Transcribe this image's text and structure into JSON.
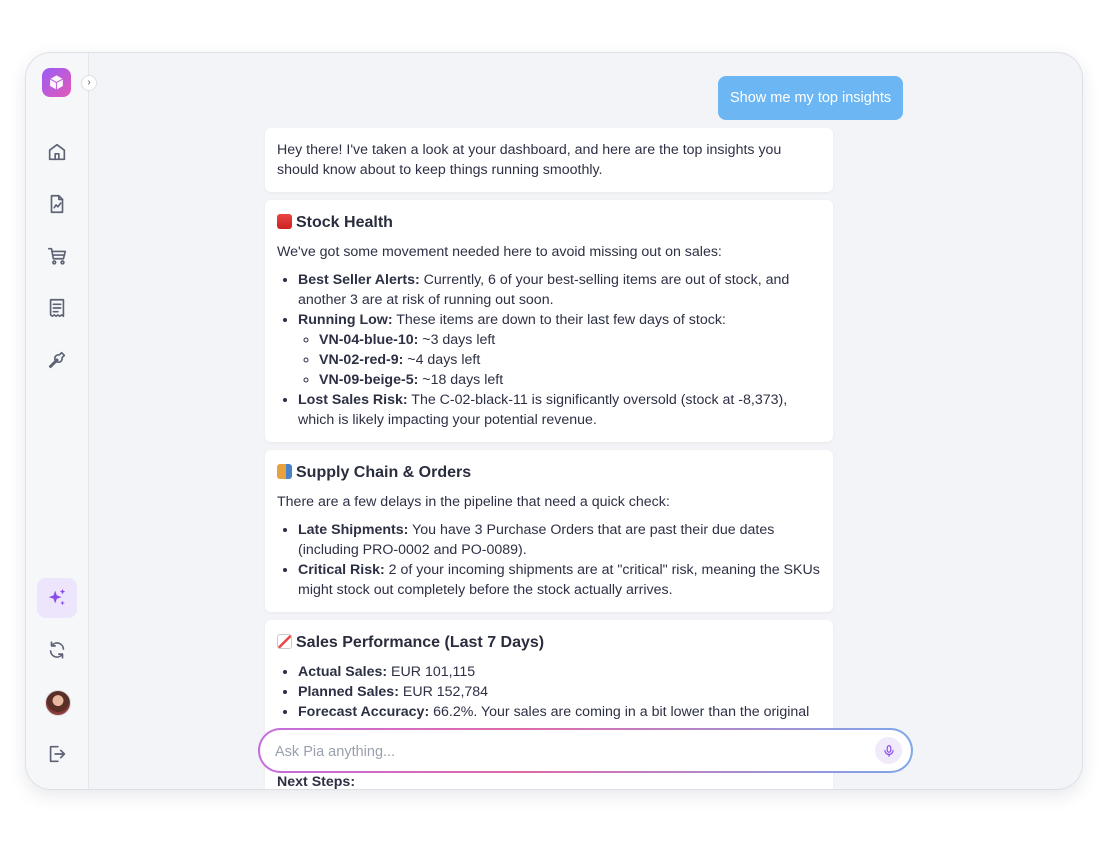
{
  "colors": {
    "accent": "#8b4de8",
    "user_bubble": "#6cb6f4"
  },
  "sidebar": {
    "items": [
      {
        "name": "home",
        "icon": "home-icon"
      },
      {
        "name": "reports",
        "icon": "report-icon"
      },
      {
        "name": "orders",
        "icon": "cart-icon"
      },
      {
        "name": "receipts",
        "icon": "receipt-icon"
      },
      {
        "name": "tools",
        "icon": "wrench-icon"
      },
      {
        "name": "ai-assistant",
        "icon": "sparkles-icon",
        "active": true
      },
      {
        "name": "sync",
        "icon": "refresh-icon"
      },
      {
        "name": "logout",
        "icon": "logout-icon"
      }
    ],
    "expand_glyph": "›"
  },
  "chat": {
    "user_message": "Show me my top insights",
    "intro": "Hey there! I've taken a look at your dashboard, and here are the top insights you should know about to keep things running smoothly.",
    "stock": {
      "title": "Stock Health",
      "lead": "We've got some movement needed here to avoid missing out on sales:",
      "b1_label": "Best Seller Alerts:",
      "b1_text": " Currently, 6 of your best-selling items are out of stock, and another 3 are at risk of running out soon.",
      "b2_label": "Running Low:",
      "b2_text": " These items are down to their last few days of stock:",
      "sub": [
        {
          "label": "VN-04-blue-10:",
          "text": " ~3 days left"
        },
        {
          "label": "VN-02-red-9:",
          "text": " ~4 days left"
        },
        {
          "label": "VN-09-beige-5:",
          "text": " ~18 days left"
        }
      ],
      "b3_label": "Lost Sales Risk:",
      "b3_text": " The C-02-black-11 is significantly oversold (stock at -8,373), which is likely impacting your potential revenue."
    },
    "supply": {
      "title": "Supply Chain & Orders",
      "lead": "There are a few delays in the pipeline that need a quick check:",
      "b1_label": "Late Shipments:",
      "b1_text": " You have 3 Purchase Orders that are past their due dates (including PRO-0002 and PO-0089).",
      "b2_label": "Critical Risk:",
      "b2_text": " 2 of your incoming shipments are at \"critical\" risk, meaning the SKUs might stock out completely before the stock actually arrives."
    },
    "sales": {
      "title": "Sales Performance (Last 7 Days)",
      "b1_label": "Actual Sales:",
      "b1_text": " EUR 101,115",
      "b2_label": "Planned Sales:",
      "b2_text": " EUR 152,784",
      "b3_label": "Forecast Accuracy:",
      "b3_text": " 66.2%. Your sales are coming in a bit lower than the original",
      "next_steps": "Next Steps:"
    }
  },
  "composer": {
    "placeholder": "Ask Pia anything..."
  }
}
